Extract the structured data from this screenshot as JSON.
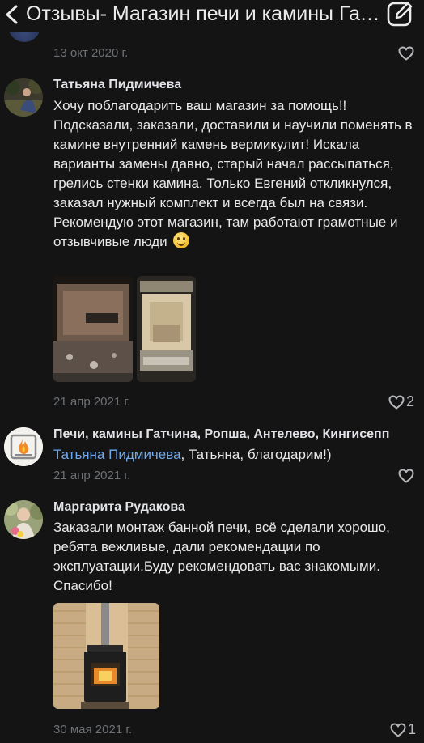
{
  "header": {
    "title": "Отзывы- Магазин печи и камины Гатчина",
    "back_icon": "chevron-left-icon",
    "edit_icon": "compose-icon"
  },
  "comments": [
    {
      "date": "13 окт 2020 г.",
      "likes": ""
    },
    {
      "author": "Татьяна Пидмичева",
      "text": "Хочу поблагодарить ваш магазин за помощь!! Подсказали, заказали, доставили и научили поменять в камине внутренний камень вермикулит! Искала варианты замены давно, старый начал рассыпаться, грелись стенки камина. Только Евгений откликнулся, заказал нужный комплект и всегда был на связи. Рекомендую этот магазин, там работают грамотные и отзывчивые люди",
      "date": "21 апр 2021 г.",
      "likes": "2"
    },
    {
      "author": "Печи, камины Гатчина, Ропша, Антелево, Кингисепп",
      "mention": "Татьяна Пидмичева",
      "text": ", Татьяна, благодарим!)",
      "date": "21 апр 2021 г.",
      "likes": ""
    },
    {
      "author": "Маргарита Рудакова",
      "text": "Заказали монтаж банной печи, всё сделали хорошо, ребята вежливые, дали рекомендации по эксплуатации.Буду рекомендовать вас знакомыми. Спасибо!",
      "date": "30 мая 2021 г.",
      "likes": "1"
    }
  ],
  "colors": {
    "background": "#141414",
    "link": "#71aaeb",
    "secondary": "#6d7175"
  }
}
